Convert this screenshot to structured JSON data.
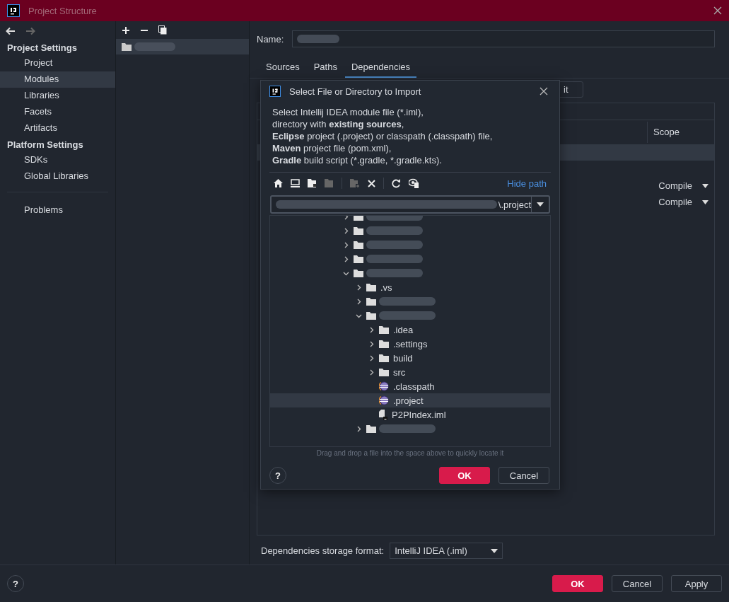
{
  "window": {
    "title": "Project Structure"
  },
  "sidebar": {
    "sections": [
      {
        "title": "Project Settings",
        "items": [
          {
            "label": "Project",
            "selected": false
          },
          {
            "label": "Modules",
            "selected": true
          },
          {
            "label": "Libraries",
            "selected": false
          },
          {
            "label": "Facets",
            "selected": false
          },
          {
            "label": "Artifacts",
            "selected": false
          }
        ]
      },
      {
        "title": "Platform Settings",
        "items": [
          {
            "label": "SDKs",
            "selected": false
          },
          {
            "label": "Global Libraries",
            "selected": false
          }
        ]
      }
    ],
    "bottom_items": [
      {
        "label": "Problems",
        "selected": false
      }
    ]
  },
  "modules": {
    "items": [
      {
        "kind": "redacted",
        "selected": true
      }
    ]
  },
  "content": {
    "name_label": "Name:",
    "tabs": [
      {
        "label": "Sources",
        "selected": false
      },
      {
        "label": "Paths",
        "selected": false
      },
      {
        "label": "Dependencies",
        "selected": true
      }
    ],
    "edit_button": "it",
    "table": {
      "columns": [
        "Scope"
      ],
      "rows": [
        {
          "scope": "",
          "selected": true
        },
        {
          "scope": "Compile",
          "selected": false
        },
        {
          "scope": "Compile",
          "selected": false
        }
      ]
    },
    "storage_label": "Dependencies storage format:",
    "storage_value": "IntelliJ IDEA (.iml)"
  },
  "dialog": {
    "title": "Select File or Directory to Import",
    "description": [
      "Select Intellij IDEA module file (*.iml),",
      "directory with **existing sources**,",
      "**Eclipse** project (.project) or classpath (.classpath) file,",
      "**Maven** project file (pom.xml),",
      "**Gradle** build script (*.gradle, *.gradle.kts)."
    ],
    "hide_path": "Hide path",
    "path_value": "\\.project",
    "tree": [
      {
        "kind": "folder",
        "expanded": false,
        "selected": false
      },
      {
        "kind": "folder",
        "expanded": false,
        "selected": false
      },
      {
        "kind": "folder",
        "expanded": false,
        "selected": false
      },
      {
        "kind": "folder",
        "expanded": false,
        "selected": false
      },
      {
        "kind": "folder",
        "expanded": true,
        "selected": false,
        "children": [
          {
            "kind": "folder",
            "label": ".vs",
            "expanded": false,
            "selected": false
          },
          {
            "kind": "folder",
            "expanded": false,
            "selected": false
          },
          {
            "kind": "folder",
            "expanded": true,
            "selected": false,
            "children": [
              {
                "kind": "folder",
                "label": ".idea",
                "expanded": false,
                "selected": false
              },
              {
                "kind": "folder",
                "label": ".settings",
                "expanded": false,
                "selected": false
              },
              {
                "kind": "folder",
                "label": "build",
                "expanded": false,
                "selected": false
              },
              {
                "kind": "folder",
                "label": "src",
                "expanded": false,
                "selected": false
              },
              {
                "kind": "eclipse",
                "label": ".classpath",
                "selected": false
              },
              {
                "kind": "eclipse",
                "label": ".project",
                "selected": true
              },
              {
                "kind": "module",
                "label": "P2PIndex.iml",
                "selected": false
              }
            ]
          },
          {
            "kind": "folder",
            "expanded": false,
            "selected": false
          }
        ]
      }
    ],
    "drop_hint": "Drag and drop a file into the space above to quickly locate it",
    "ok": "OK",
    "cancel": "Cancel",
    "help": "?"
  },
  "footer": {
    "help": "?",
    "ok": "OK",
    "cancel": "Cancel",
    "apply": "Apply"
  }
}
